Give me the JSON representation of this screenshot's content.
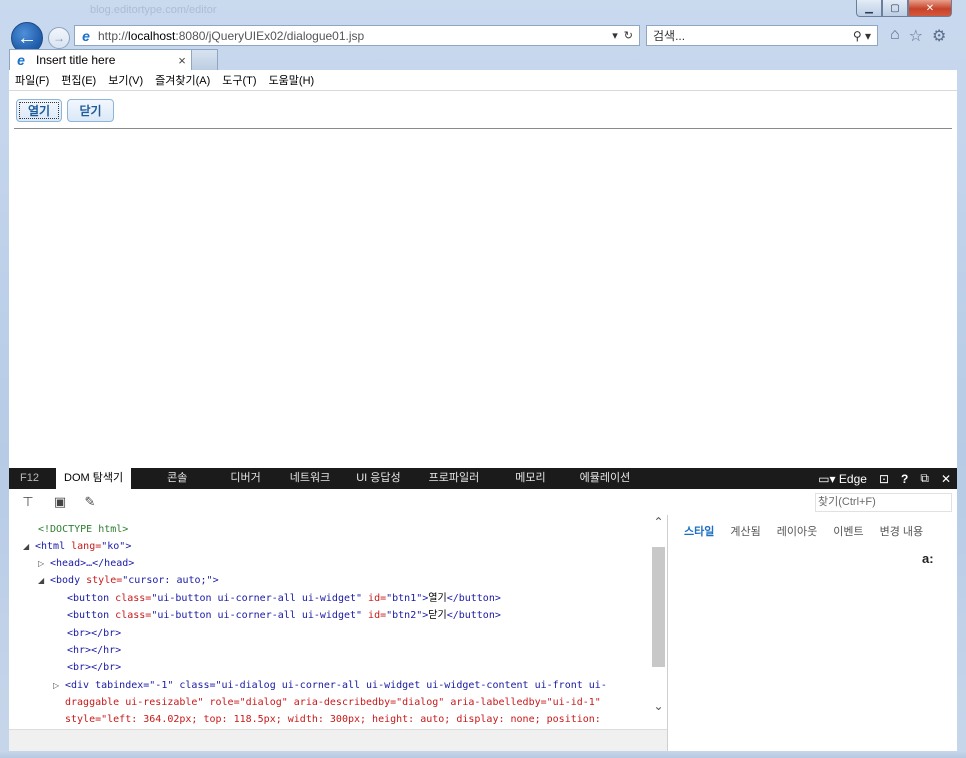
{
  "titlebar": {
    "ghost_url": "blog.editortype.com/editor"
  },
  "address": {
    "url_prefix": "http://",
    "url_host": "localhost",
    "url_rest": ":8080/jQueryUIEx02/dialogue01.jsp",
    "dropdown_glyph": "▾",
    "refresh_glyph": "↻"
  },
  "search": {
    "placeholder": "검색...",
    "tools": "⚲ ▾"
  },
  "tab": {
    "title": "Insert title here",
    "close": "×"
  },
  "menu": [
    "파일(F)",
    "편집(E)",
    "보기(V)",
    "즐겨찾기(A)",
    "도구(T)",
    "도움말(H)"
  ],
  "page": {
    "btn_open": "열기",
    "btn_close": "닫기"
  },
  "devtools": {
    "f12": "F12",
    "tabs": [
      "DOM 탐색기",
      "콘솔",
      "디버거",
      "네트워크",
      "UI 응답성",
      "프로파일러",
      "메모리",
      "에뮬레이션"
    ],
    "right": {
      "mode": "Edge",
      "help": "?",
      "undock": "⧉",
      "close": "✕"
    },
    "find_placeholder": "찾기(Ctrl+F)"
  },
  "dom": {
    "doctype": "<!DOCTYPE html>",
    "html_open": "<html",
    "html_attr": " lang=",
    "html_val": "\"ko\"",
    "head": "<head>…</head>",
    "body_open": "<body",
    "body_attr": " style=",
    "body_val": "\"cursor: auto;\"",
    "btn1_text": "열기",
    "btn2_text": "닫기",
    "br": "<br></br>",
    "hr": "<hr></hr>",
    "br2": "<br></br>",
    "div_line1": "<div tabindex=\"-1\" class=\"ui-dialog ui-corner-all ui-widget ui-widget-content ui-front ui-",
    "div_line2": "draggable ui-resizable\" role=\"dialog\" aria-describedby=\"dialog\" aria-labelledby=\"ui-id-1\"",
    "div_line3": "style=\"left: 364.02px; top: 118.5px; width: 300px; height: auto; display: none; position:"
  },
  "styles": {
    "tabs": [
      "스타일",
      "계산됨",
      "레이아웃",
      "이벤트",
      "변경 내용"
    ],
    "pin": "a:"
  }
}
